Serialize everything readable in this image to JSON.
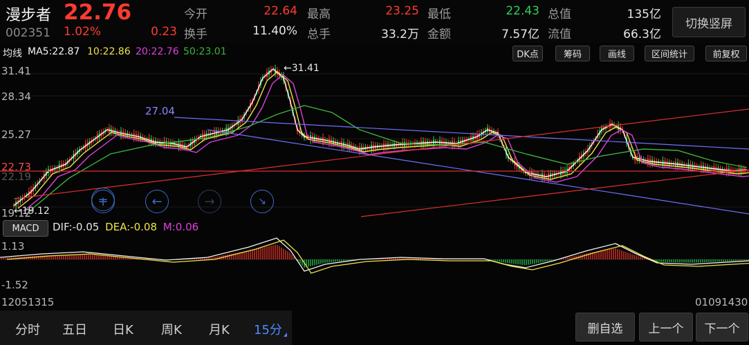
{
  "stock": {
    "name": "漫步者",
    "price": "22.76",
    "code": "002351",
    "change_pct": "1.02%",
    "change": "0.23"
  },
  "quote": [
    {
      "label": "今开",
      "value": "22.64",
      "color": "red"
    },
    {
      "label": "最高",
      "value": "23.25",
      "color": "red"
    },
    {
      "label": "最低",
      "value": "22.43",
      "color": "green"
    },
    {
      "label": "总值",
      "value": "135亿",
      "color": "white"
    },
    {
      "label": "换手",
      "value": "11.40%",
      "color": "white"
    },
    {
      "label": "总手",
      "value": "33.2万",
      "color": "white"
    },
    {
      "label": "金额",
      "value": "7.57亿",
      "color": "white"
    },
    {
      "label": "流值",
      "value": "66.3亿",
      "color": "white"
    }
  ],
  "switch_label": "切换竖屏",
  "ma": {
    "title": "均线",
    "ma5": "MA5:22.87",
    "ma10": "10:22.86",
    "ma20": "20:22.76",
    "ma50": "50:23.01"
  },
  "tools": [
    "DK点",
    "筹码",
    "画线",
    "区间统计",
    "前复权"
  ],
  "price_axis": {
    "top": "31.41",
    "mid": "28.34",
    "low": "25.27",
    "cur": "22.73",
    "faint": "22.19",
    "bottom": "19.12"
  },
  "annotations": {
    "high": "←31.41",
    "low": "←19.12",
    "trend": "27.04"
  },
  "macd": {
    "tag": "MACD",
    "dif": "DIF:-0.05",
    "dea": "DEA:-0.08",
    "m": "M:0.06",
    "axis_top": "1.13",
    "axis_bottom": "-1.52"
  },
  "time_axis": {
    "start": "12051315",
    "end": "01091430"
  },
  "tabs": [
    {
      "label": "分时",
      "active": false
    },
    {
      "label": "五日",
      "active": false
    },
    {
      "label": "日K",
      "active": false
    },
    {
      "label": "周K",
      "active": false
    },
    {
      "label": "月K",
      "active": false
    },
    {
      "label": "15分",
      "active": true
    }
  ],
  "bottom_buttons": {
    "remove": "删自选",
    "prev": "上一个",
    "next": "下一个"
  },
  "controls": [
    "minus-icon",
    "plus-icon",
    "arrow-left-icon",
    "arrow-right-icon",
    "collapse-icon"
  ],
  "colors": {
    "up": "#ff3b30",
    "down": "#2ed15a",
    "ma5": "#f5f5f5",
    "ma10": "#f0e44a",
    "ma20": "#e040e0",
    "ma50": "#3bb33b",
    "trendline": "#7070ff",
    "support": "#e03030"
  }
}
